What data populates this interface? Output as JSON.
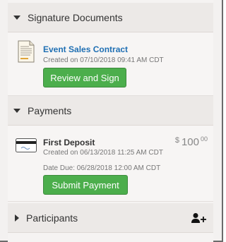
{
  "signature_section": {
    "title": "Signature Documents",
    "document": {
      "name": "Event Sales Contract",
      "created": "Created on 07/10/2018 09:41 AM CDT",
      "button": "Review and Sign",
      "icon": "document-icon"
    }
  },
  "payments_section": {
    "title": "Payments",
    "payment": {
      "name": "First Deposit",
      "created": "Created on 06/13/2018 11:25 AM CDT",
      "due": "Date Due: 06/28/2018 12:00 AM CDT",
      "amount_currency": "$",
      "amount_whole": "100",
      "amount_cents": "00",
      "button": "Submit Payment",
      "icon": "credit-card-icon"
    }
  },
  "participants_section": {
    "title": "Participants",
    "icon": "add-person-icon"
  },
  "colors": {
    "link": "#1f6fb3",
    "button_green": "#4cae4c"
  }
}
